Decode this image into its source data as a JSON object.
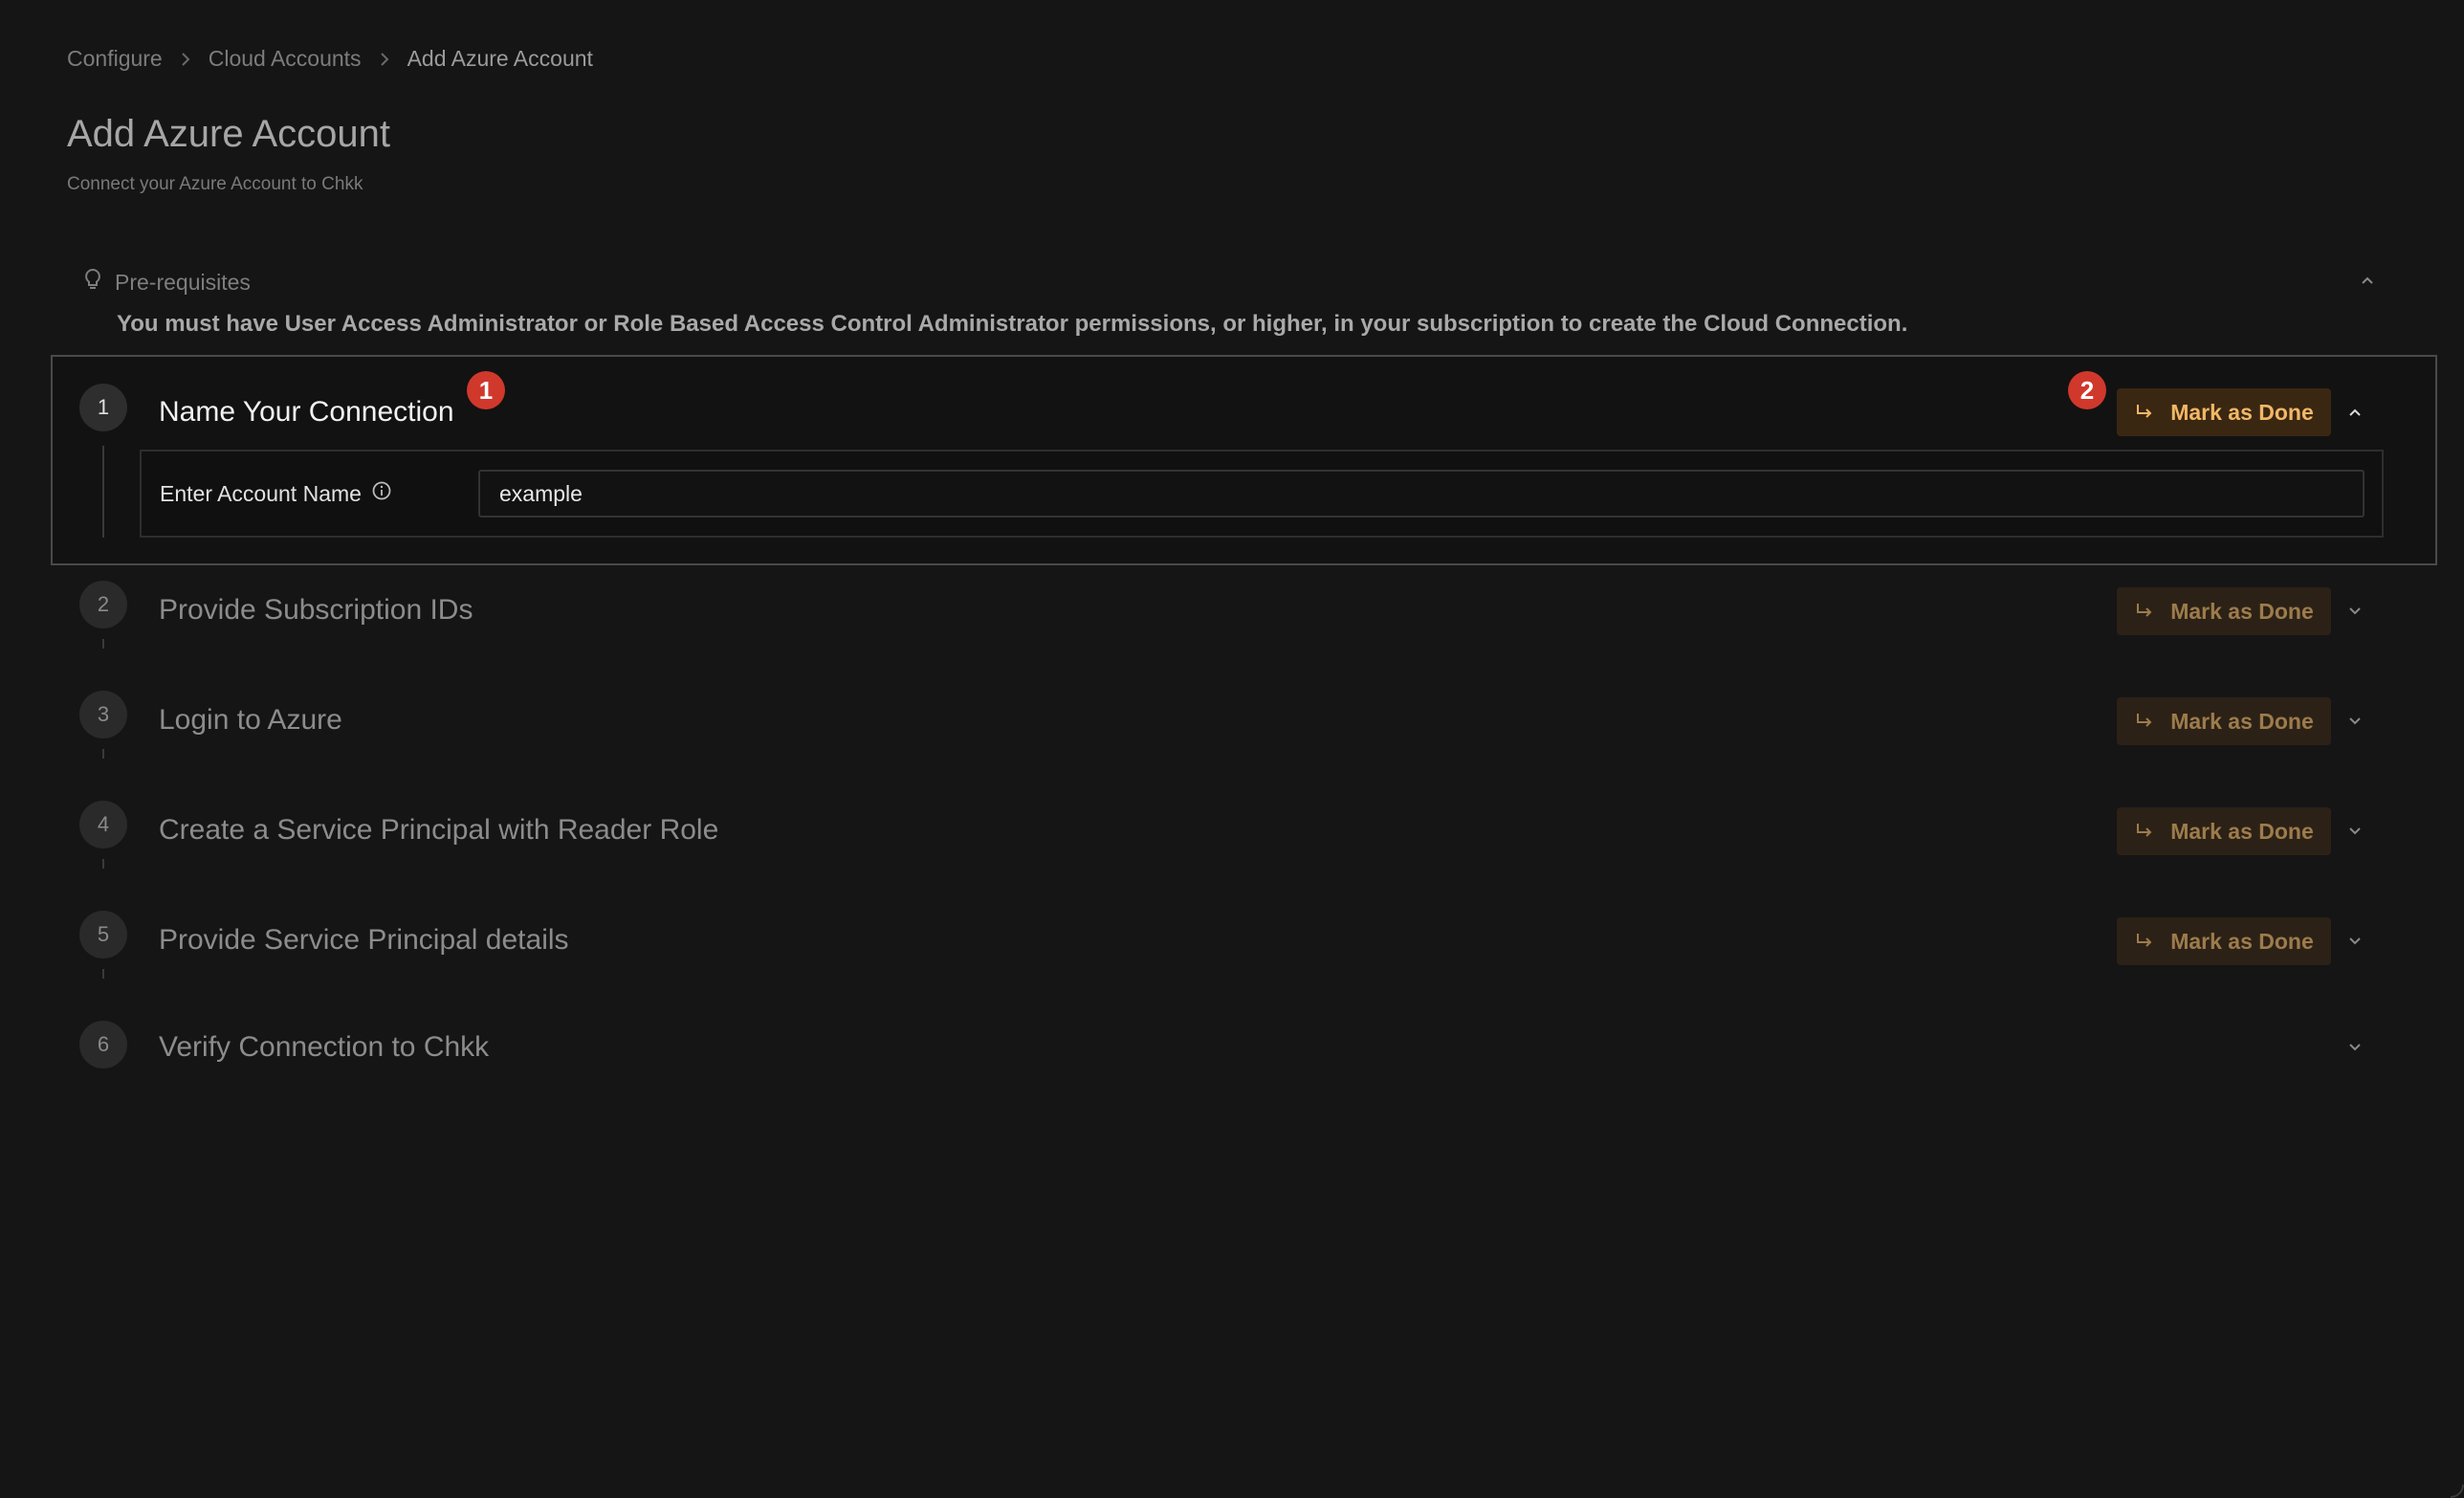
{
  "breadcrumb": [
    "Configure",
    "Cloud Accounts",
    "Add Azure Account"
  ],
  "title": "Add Azure Account",
  "subtitle": "Connect your Azure Account to Chkk",
  "prerequisites": {
    "label": "Pre-requisites",
    "text": "You must have User Access Administrator or Role Based Access Control Administrator permissions, or higher, in your subscription to create the Cloud Connection."
  },
  "mark_done_label": "Mark as Done",
  "badges": [
    "1",
    "2"
  ],
  "steps": [
    {
      "number": "1",
      "title": "Name Your Connection",
      "field_label": "Enter Account Name",
      "field_value": "example"
    },
    {
      "number": "2",
      "title": "Provide Subscription IDs"
    },
    {
      "number": "3",
      "title": "Login to Azure"
    },
    {
      "number": "4",
      "title": "Create a Service Principal with Reader Role"
    },
    {
      "number": "5",
      "title": "Provide Service Principal details"
    },
    {
      "number": "6",
      "title": "Verify Connection to Chkk"
    }
  ],
  "colors": {
    "background": "#151515",
    "accent": "#f2b866",
    "badge": "#d0382c"
  }
}
